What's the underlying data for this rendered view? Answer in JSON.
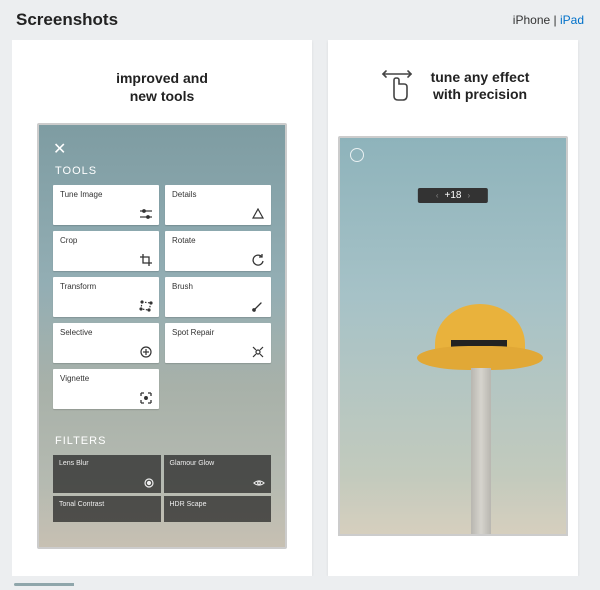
{
  "section_title": "Screenshots",
  "device_tabs": {
    "iphone": "iPhone",
    "sep": " | ",
    "ipad": "iPad"
  },
  "colors": {
    "link": "#0070c9"
  },
  "shot1": {
    "caption_line1": "improved and",
    "caption_line2": "new tools",
    "tools_header": "TOOLS",
    "tools": [
      {
        "label": "Tune Image",
        "icon": "tune-image-icon"
      },
      {
        "label": "Details",
        "icon": "details-icon"
      },
      {
        "label": "Crop",
        "icon": "crop-icon"
      },
      {
        "label": "Rotate",
        "icon": "rotate-icon"
      },
      {
        "label": "Transform",
        "icon": "transform-icon"
      },
      {
        "label": "Brush",
        "icon": "brush-icon"
      },
      {
        "label": "Selective",
        "icon": "selective-icon"
      },
      {
        "label": "Spot Repair",
        "icon": "spot-repair-icon"
      },
      {
        "label": "Vignette",
        "icon": "vignette-icon"
      }
    ],
    "filters_header": "FILTERS",
    "filters": [
      {
        "label": "Lens Blur",
        "icon": "lens-blur-icon"
      },
      {
        "label": "Glamour Glow",
        "icon": "glamour-glow-icon"
      },
      {
        "label": "Tonal Contrast",
        "icon": ""
      },
      {
        "label": "HDR Scape",
        "icon": ""
      }
    ]
  },
  "shot2": {
    "caption_line1": "tune any effect",
    "caption_line2": "with precision",
    "value_display": "+18"
  }
}
